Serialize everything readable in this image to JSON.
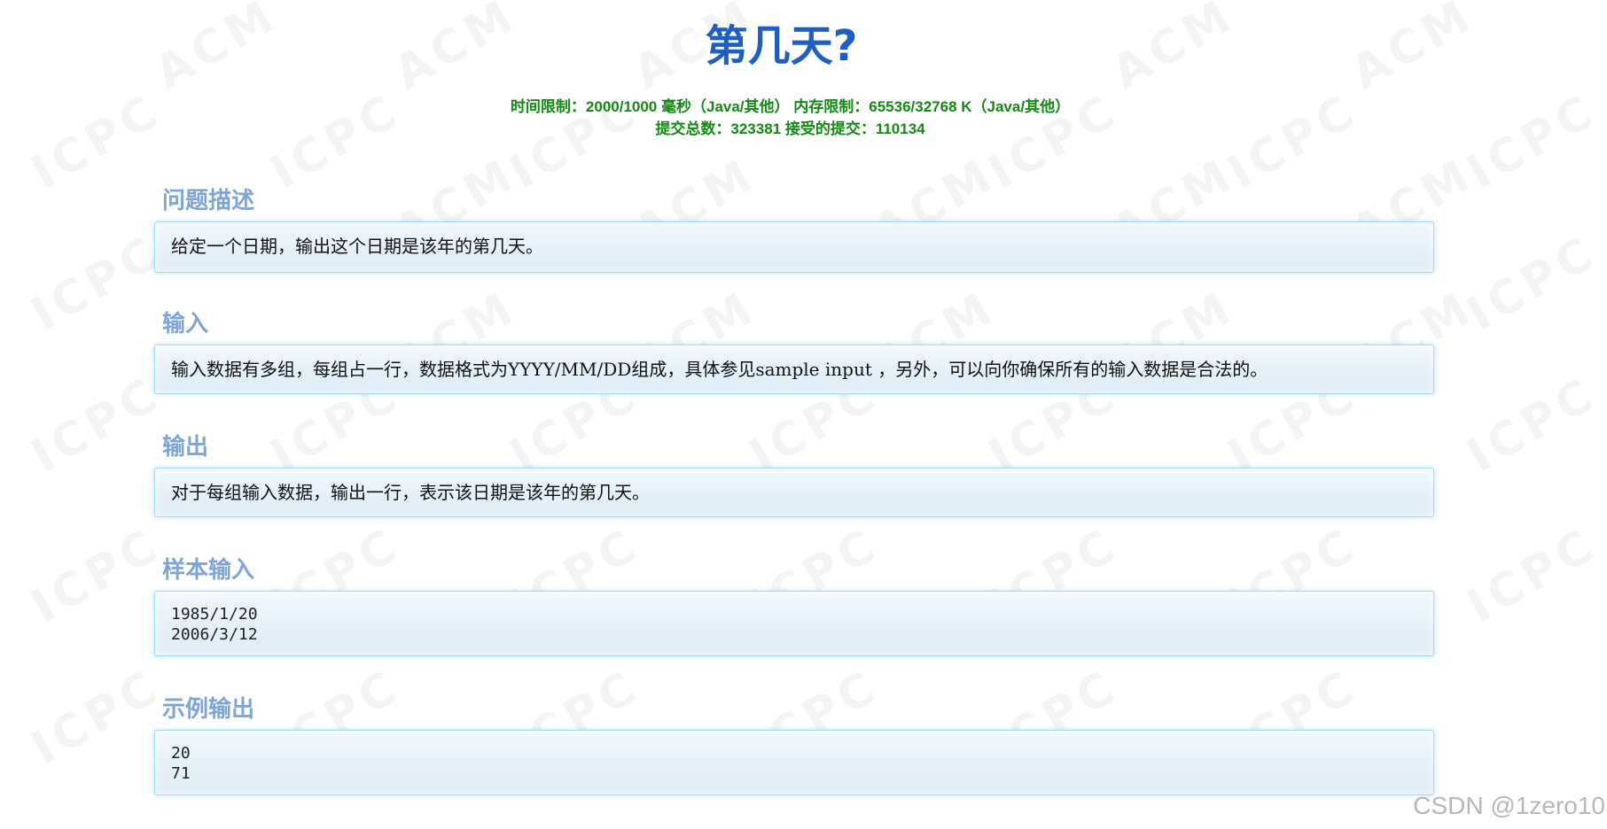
{
  "problem": {
    "title": "第几天?",
    "limits_line1": "时间限制：2000/1000 毫秒（Java/其他） 内存限制：65536/32768 K（Java/其他）",
    "limits_line2": "提交总数：323381 接受的提交：110134"
  },
  "sections": {
    "description": {
      "heading": "问题描述",
      "text": "给定一个日期，输出这个日期是该年的第几天。"
    },
    "input": {
      "heading": "输入",
      "text": "输入数据有多组，每组占一行，数据格式为YYYY/MM/DD组成，具体参见sample input ，另外，可以向你确保所有的输入数据是合法的。"
    },
    "output": {
      "heading": "输出",
      "text": "对于每组输入数据，输出一行，表示该日期是该年的第几天。"
    },
    "sample_input": {
      "heading": "样本输入",
      "text": "1985/1/20\n2006/3/12"
    },
    "sample_output": {
      "heading": "示例输出",
      "text": "20\n71"
    }
  },
  "watermark": {
    "text_acm": "ACM",
    "text_icpc": "ICPC"
  },
  "footer": {
    "attribution": "CSDN @1zero10"
  },
  "colors": {
    "title": "#1f5fc4",
    "limits": "#138a13",
    "section_heading": "#7ea5d8",
    "box_border": "#a9d8f5",
    "box_background": "#e3f0f9"
  }
}
